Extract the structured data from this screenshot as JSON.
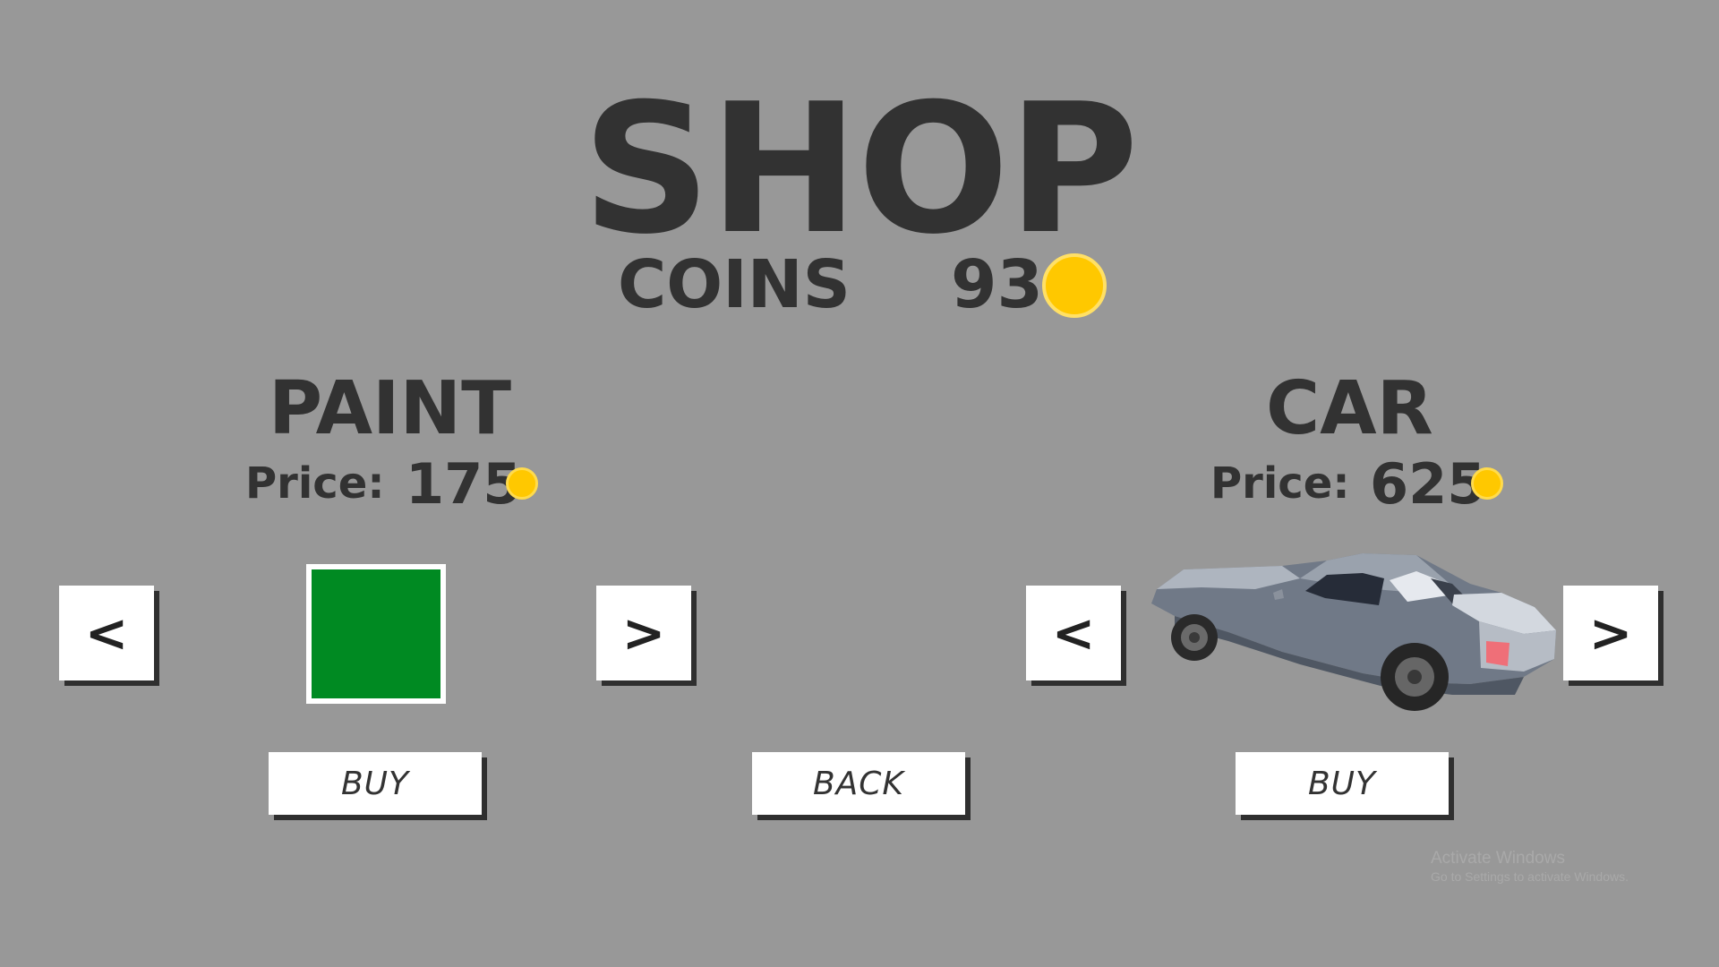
{
  "colors": {
    "background": "#989898",
    "text": "#323232",
    "coin": "#ffc800",
    "paint_swatch": "#008a22",
    "button_bg": "#ffffff",
    "button_shadow": "#2f2f2f"
  },
  "header": {
    "title": "SHOP",
    "coins_label": "COINS",
    "coins_value": "93",
    "coin_icon": "coin-icon"
  },
  "paint": {
    "title": "PAINT",
    "price_label": "Price:",
    "price_value": "175",
    "prev_label": "<",
    "next_label": ">",
    "buy_label": "BUY"
  },
  "car": {
    "title": "CAR",
    "price_label": "Price:",
    "price_value": "625",
    "prev_label": "<",
    "next_label": ">",
    "buy_label": "BUY",
    "preview": "car-preview-icon"
  },
  "back_label": "BACK",
  "watermark": {
    "line1": "Activate Windows",
    "line2": "Go to Settings to activate Windows."
  }
}
